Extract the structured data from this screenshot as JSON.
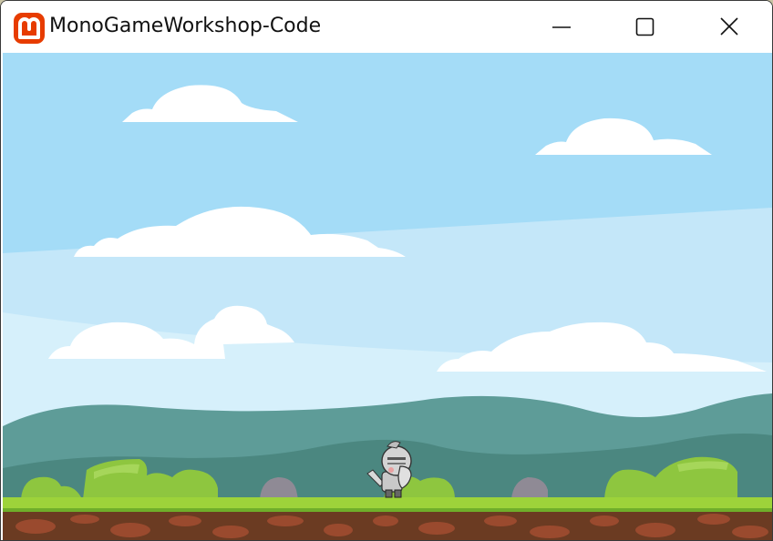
{
  "window": {
    "title": "MonoGameWorkshop-Code",
    "app_icon": "monogame-logo-icon",
    "controls": {
      "minimize": "minimize-icon",
      "maximize": "maximize-icon",
      "close": "close-icon"
    }
  },
  "game": {
    "scene": "side-scrolling platformer level",
    "player_character": "armored knight with sword and shield",
    "colors": {
      "sky_top": "#a4dcf7",
      "sky_band": "#cdebfa",
      "cloud": "#ffffff",
      "far_hills": "#5a9a98",
      "near_hills": "#4a847e",
      "bushes": "#8ec63f",
      "grass": "#9dd33a",
      "dirt": "#6b3b22",
      "dirt_stones": "#9a4a2e",
      "rocks": "#8f8a95"
    }
  }
}
